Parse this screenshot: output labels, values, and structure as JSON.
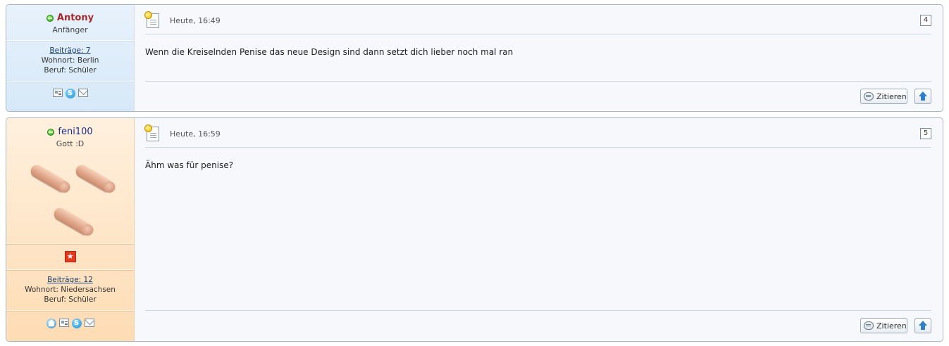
{
  "posts": [
    {
      "author": {
        "name": "Antony",
        "rank": "Anfänger",
        "posts_label": "Beiträge: 7",
        "location": "Wohnort: Berlin",
        "job": "Beruf: Schüler",
        "contact_icons": [
          "profile-icon",
          "skype-icon",
          "email-icon"
        ]
      },
      "date": "Heute, 16:49",
      "number": "4",
      "text": "Wenn die Kreiselnden Penise das neue Design sind dann setzt dich lieber noch mal ran",
      "quote_label": "Zitieren"
    },
    {
      "author": {
        "name": "feni100",
        "rank": "Gott :D",
        "posts_label": "Beiträge: 12",
        "location": "Wohnort: Niedersachsen",
        "job": "Beruf: Schüler",
        "contact_icons": [
          "home-icon",
          "profile-icon",
          "skype-icon",
          "email-icon"
        ]
      },
      "date": "Heute, 16:59",
      "number": "5",
      "text": "Ähm was für penise?",
      "quote_label": "Zitieren"
    }
  ],
  "colors": {
    "post1_sidebar": "#deedfa",
    "post2_sidebar": "#fee6c8",
    "post1_name": "#a52a2a",
    "post2_name": "#1a2d8a",
    "border": "#a9b8c2"
  }
}
